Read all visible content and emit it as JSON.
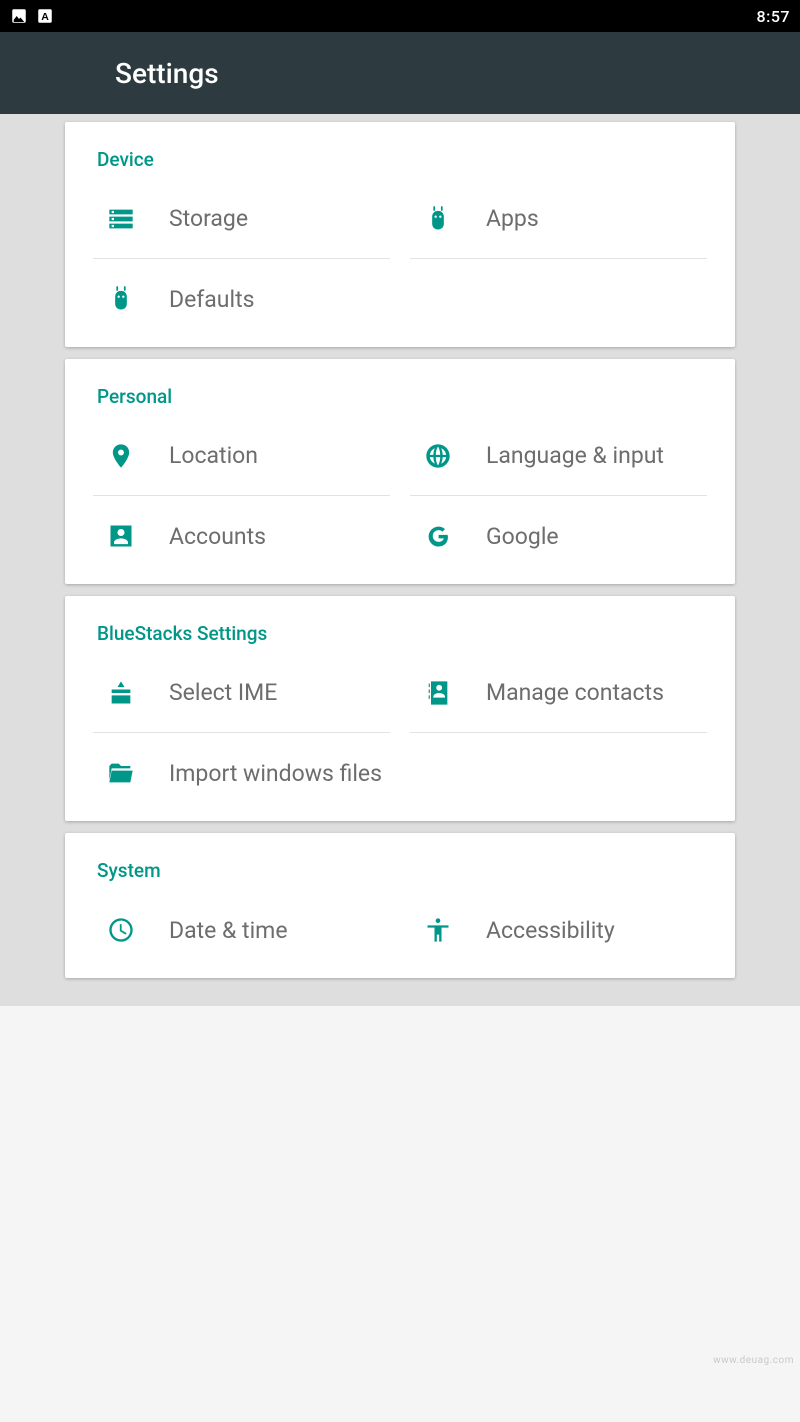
{
  "status": {
    "time": "8:57"
  },
  "appbar": {
    "title": "Settings"
  },
  "sections": {
    "device": {
      "title": "Device",
      "items": [
        {
          "label": "Storage"
        },
        {
          "label": "Apps"
        },
        {
          "label": "Defaults"
        }
      ]
    },
    "personal": {
      "title": "Personal",
      "items": [
        {
          "label": "Location"
        },
        {
          "label": "Language & input"
        },
        {
          "label": "Accounts"
        },
        {
          "label": "Google"
        }
      ]
    },
    "bluestacks": {
      "title": "BlueStacks Settings",
      "items": [
        {
          "label": "Select IME"
        },
        {
          "label": "Manage contacts"
        },
        {
          "label": "Import windows files"
        }
      ]
    },
    "system": {
      "title": "System",
      "items": [
        {
          "label": "Date & time"
        },
        {
          "label": "Accessibility"
        }
      ]
    }
  },
  "watermark": "www.deuag.com"
}
